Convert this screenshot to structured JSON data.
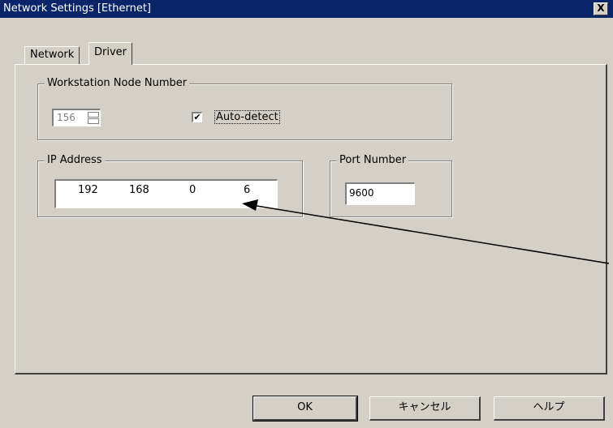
{
  "window": {
    "title": "Network Settings [Ethernet]",
    "close_label": "X"
  },
  "tabs": [
    {
      "label": "Network"
    },
    {
      "label": "Driver"
    }
  ],
  "workstation_group": {
    "legend": "Workstation Node Number",
    "spinner_value": "156",
    "auto_detect_label": "Auto-detect",
    "auto_detect_checked": "✔"
  },
  "ip_group": {
    "legend": "IP Address",
    "octets": [
      "192",
      "168",
      "0",
      "6"
    ]
  },
  "port_group": {
    "legend": "Port Number",
    "value": "9600"
  },
  "buttons": {
    "ok": "OK",
    "cancel": "キャンセル",
    "help": "ヘルプ"
  }
}
